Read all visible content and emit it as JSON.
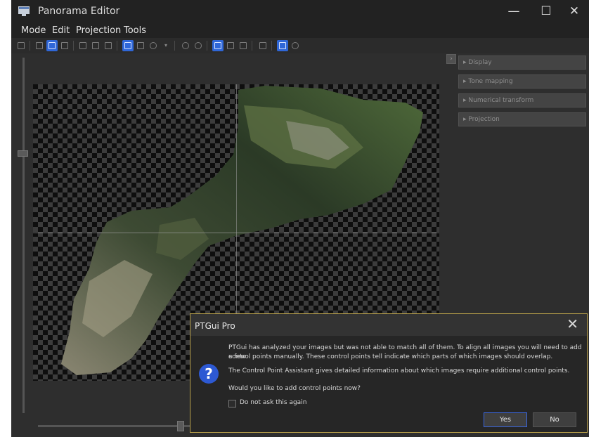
{
  "window": {
    "title": "Panorama Editor",
    "minimize": "—",
    "maximize": "☐",
    "close": "✕"
  },
  "menu": [
    "Mode",
    "Edit",
    "Projection",
    "Tools"
  ],
  "panels": [
    "▸ Display",
    "▸ Tone mapping",
    "▸ Numerical transform",
    "▸ Projection"
  ],
  "panel_toggle": "›",
  "dialog": {
    "title": "PTGui Pro",
    "close": "✕",
    "icon_glyph": "?",
    "message1_line1": "PTGui has analyzed your images but was not able to match all of them. To align all images you will need to add a few",
    "message1_line2": "control points manually. These control points tell indicate which parts of which images should overlap.",
    "message2": "The Control Point Assistant gives detailed information about which images require additional control points.",
    "message3": "Would you like to add control points now?",
    "checkbox_label": "Do not ask this again",
    "yes": "Yes",
    "no": "No"
  },
  "colors": {
    "accent": "#2f67d8",
    "dialog_border": "#b8a04a"
  }
}
